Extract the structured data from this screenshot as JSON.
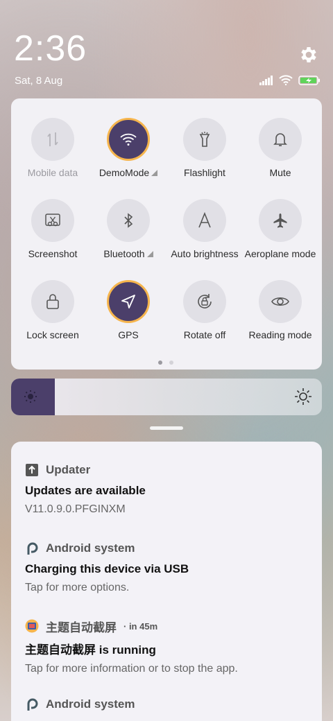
{
  "status": {
    "clock": "2:36",
    "date": "Sat, 8 Aug"
  },
  "quick_settings": {
    "tiles": [
      {
        "label": "Mobile data",
        "icon": "mobile-data-icon",
        "on": false
      },
      {
        "label": "DemoMode",
        "icon": "wifi-icon",
        "on": true
      },
      {
        "label": "Flashlight",
        "icon": "flashlight-icon",
        "on": false
      },
      {
        "label": "Mute",
        "icon": "bell-icon",
        "on": false
      },
      {
        "label": "Screenshot",
        "icon": "screenshot-icon",
        "on": false
      },
      {
        "label": "Bluetooth",
        "icon": "bluetooth-icon",
        "on": false
      },
      {
        "label": "Auto brightness",
        "icon": "auto-brightness-icon",
        "on": false
      },
      {
        "label": "Aeroplane mode",
        "icon": "airplane-icon",
        "on": false
      },
      {
        "label": "Lock screen",
        "icon": "lock-icon",
        "on": false
      },
      {
        "label": "GPS",
        "icon": "location-arrow-icon",
        "on": true
      },
      {
        "label": "Rotate off",
        "icon": "rotate-lock-icon",
        "on": false
      },
      {
        "label": "Reading mode",
        "icon": "eye-icon",
        "on": false
      }
    ],
    "page_count": 2,
    "current_page": 1
  },
  "brightness": {
    "level": 0.14
  },
  "notifications": [
    {
      "app": "Updater",
      "time": "",
      "title": "Updates are available",
      "body": "V11.0.9.0.PFGINXM",
      "icon": "update-arrow-icon"
    },
    {
      "app": "Android system",
      "time": "",
      "title": "Charging this device via USB",
      "body": "Tap for more options.",
      "icon": "android-p-icon"
    },
    {
      "app": "主题自动截屏",
      "time": "· in 45m",
      "title": "主题自动截屏 is running",
      "body": "Tap for more information or to stop the app.",
      "icon": "theme-app-icon"
    },
    {
      "app": "Android system",
      "time": "",
      "title": "",
      "body": "",
      "icon": "android-p-icon"
    }
  ],
  "colors": {
    "accent": "#4b3f6a",
    "active_ring": "#f6b54d",
    "battery": "#5fd35a"
  }
}
